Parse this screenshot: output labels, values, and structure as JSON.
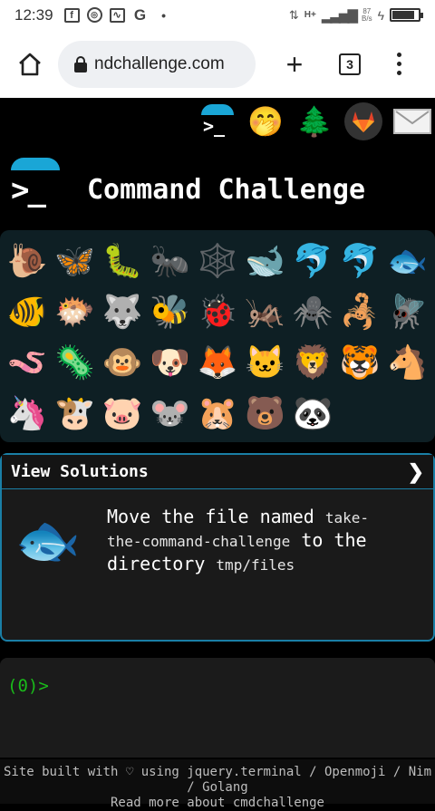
{
  "status_bar": {
    "time": "12:39",
    "dot": "•",
    "network_type": "H+",
    "net_speed_value": "87",
    "net_speed_unit": "B/s",
    "battery_level": 0.85
  },
  "browser": {
    "url": "ndchallenge.com",
    "tab_count": "3"
  },
  "header_icons": {
    "hand_over_mouth": "🤭",
    "tree": "🌲",
    "gitlab_label": "GitLab",
    "mail_label": "Mail"
  },
  "page": {
    "title": "Command Challenge"
  },
  "emoji": [
    "🐌",
    "🦋",
    "🐛",
    "🐜",
    "🕸️",
    "🐋",
    "🐬",
    "🐬",
    "🐟",
    "🐠",
    "🐡",
    "🐺",
    "🐝",
    "🐞",
    "🦗",
    "🕷️",
    "🦂",
    "🪰",
    "🪱",
    "🦠",
    "🐵",
    "🐶",
    "🦊",
    "🐱",
    "🦁",
    "🐯",
    "🐴",
    "🦄",
    "🐮",
    "🐷",
    "🐭",
    "🐹",
    "🐻",
    "🐼"
  ],
  "solutions": {
    "title": "View Solutions",
    "chevron": "❯"
  },
  "challenge": {
    "icon": "🐟",
    "text_part1": "Move the file named ",
    "code1": "take-the-command-challenge",
    "text_part2": " to the directory ",
    "code2": "tmp/files"
  },
  "terminal": {
    "prompt": "(0)>"
  },
  "footer": {
    "line1": "Site built with ♡ using jquery.terminal / Openmoji / Nim / Golang",
    "line2": "Read more about cmdchallenge"
  }
}
